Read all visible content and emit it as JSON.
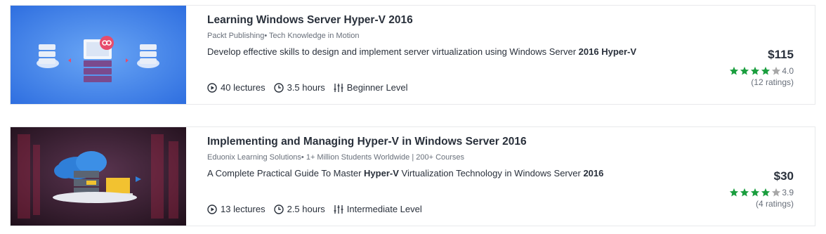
{
  "courses": [
    {
      "title": "Learning Windows Server Hyper-V 2016",
      "byline": "Packt Publishing• Tech Knowledge in Motion",
      "headline_parts": [
        "Develop effective skills to design and implement server virtualization using Windows Server ",
        "2016 Hyper-V"
      ],
      "lectures": "40 lectures",
      "duration": "3.5 hours",
      "level": "Beginner Level",
      "price": "$115",
      "rating": "4.0",
      "rating_stars": 4,
      "ratings_count": "(12 ratings)",
      "thumbnail_icon": "server-virtualization-illustration"
    },
    {
      "title": "Implementing and Managing Hyper-V in Windows Server 2016",
      "byline": "Eduonix Learning Solutions• 1+ Million Students Worldwide | 200+ Courses",
      "headline_parts": [
        "A Complete Practical Guide To Master ",
        "Hyper-V",
        " Virtualization Technology in Windows Server ",
        "2016"
      ],
      "lectures": "13 lectures",
      "duration": "2.5 hours",
      "level": "Intermediate Level",
      "price": "$30",
      "rating": "3.9",
      "rating_stars": 4,
      "ratings_count": "(4 ratings)",
      "thumbnail_icon": "cloud-datacenter-illustration"
    }
  ],
  "colors": {
    "star_filled": "#1a9e3e",
    "star_empty": "#a8a8a8",
    "thumb1_bg": "#3f7ee8",
    "thumb2_bg": "#3a1f2e"
  }
}
